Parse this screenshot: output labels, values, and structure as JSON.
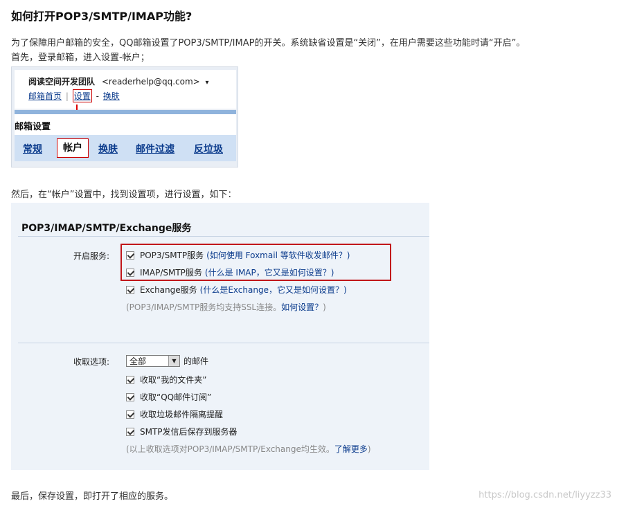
{
  "article": {
    "title": "如何打开POP3/SMTP/IMAP功能?",
    "intro_line1": "为了保障用户邮箱的安全，QQ邮箱设置了POP3/SMTP/IMAP的开关。系统缺省设置是“关闭”，在用户需要这些功能时请“开启”。",
    "intro_line2": "首先，登录邮箱，进入设置-帐户；",
    "step2": "然后，在“帐户”设置中，找到设置项，进行设置，如下：",
    "final": "最后，保存设置，即打开了相应的服务。",
    "watermark": "https://blog.csdn.net/liyyzz33"
  },
  "shot1": {
    "user_name": "阅读空间开发团队",
    "user_email": "<readerhelp@qq.com>",
    "dropdown_arrow": "▾",
    "link_home": "邮箱首页",
    "separator1": "|",
    "link_settings": "设置",
    "separator2": "-",
    "link_skin": "换肤",
    "settings_title": "邮箱设置",
    "tabs": [
      "常规",
      "帐户",
      "换肤",
      "邮件过滤",
      "反垃圾"
    ]
  },
  "shot2": {
    "heading": "POP3/IMAP/SMTP/Exchange服务",
    "enable_label": "开启服务:",
    "services": [
      {
        "name": "POP3/SMTP服务",
        "hint": "(如何使用 Foxmail 等软件收发邮件？)",
        "checked": true
      },
      {
        "name": "IMAP/SMTP服务",
        "hint": "(什么是 IMAP，它又是如何设置？)",
        "checked": true
      },
      {
        "name": "Exchange服务",
        "hint": "(什么是Exchange，它又是如何设置？)",
        "checked": true
      }
    ],
    "ssl_note_prefix": "(POP3/IMAP/SMTP服务均支持SSL连接。",
    "ssl_note_link": "如何设置？",
    "ssl_note_suffix": ")",
    "receive_label": "收取选项:",
    "receive_select": "全部",
    "receive_select_suffix": "的邮件",
    "receive_options": [
      {
        "label": "收取“我的文件夹”",
        "checked": true
      },
      {
        "label": "收取“QQ邮件订阅”",
        "checked": true
      },
      {
        "label": "收取垃圾邮件隔离提醒",
        "checked": true
      },
      {
        "label": "SMTP发信后保存到服务器",
        "checked": true
      }
    ],
    "bottom_note_prefix": "(以上收取选项对POP3/IMAP/SMTP/Exchange均生效。",
    "bottom_note_link": "了解更多",
    "bottom_note_suffix": ")"
  },
  "colors": {
    "link": "#0b3b8c",
    "highlight_red": "#c1151a",
    "panel_bg": "#eef3f9",
    "tab_bg": "#cfe0f4"
  }
}
